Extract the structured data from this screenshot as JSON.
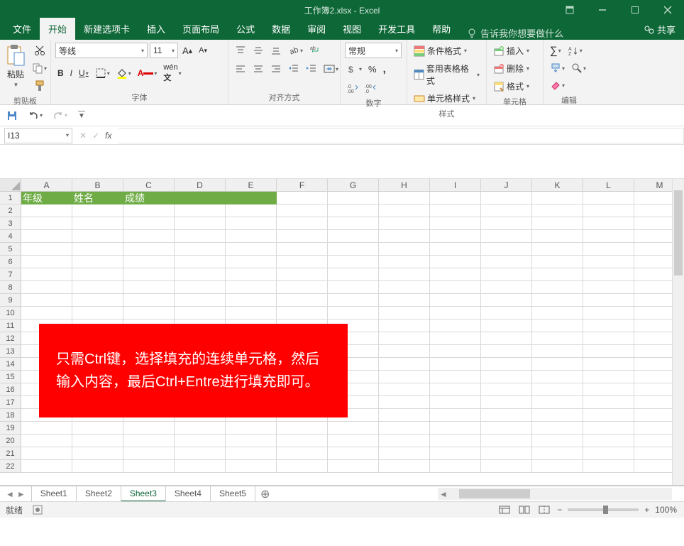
{
  "title": "工作簿2.xlsx  -  Excel",
  "menubar": {
    "file": "文件",
    "home": "开始",
    "new": "新建选项卡",
    "insert": "插入",
    "layout": "页面布局",
    "formula": "公式",
    "data": "数据",
    "review": "审阅",
    "view": "视图",
    "dev": "开发工具",
    "help": "帮助",
    "tell": "告诉我你想要做什么",
    "share": "共享"
  },
  "ribbon": {
    "clipboard": {
      "label": "剪贴板",
      "paste": "粘贴"
    },
    "font": {
      "label": "字体",
      "name": "等线",
      "size": "11",
      "bold": "B",
      "italic": "I",
      "underline": "U"
    },
    "align": {
      "label": "对齐方式"
    },
    "number": {
      "label": "数字",
      "format": "常规"
    },
    "styles": {
      "label": "样式",
      "cond": "条件格式",
      "table": "套用表格格式",
      "cell": "单元格样式"
    },
    "cells": {
      "label": "单元格",
      "insert": "插入",
      "delete": "删除",
      "format": "格式"
    },
    "editing": {
      "label": "编辑"
    }
  },
  "namebox": "I13",
  "columns": [
    "A",
    "B",
    "C",
    "D",
    "E",
    "F",
    "G",
    "H",
    "I",
    "J",
    "K",
    "L",
    "M"
  ],
  "rows": [
    "1",
    "2",
    "3",
    "4",
    "5",
    "6",
    "7",
    "8",
    "9",
    "10",
    "11",
    "12",
    "13",
    "14",
    "15",
    "16",
    "17",
    "18",
    "19",
    "20",
    "21",
    "22"
  ],
  "header_row": {
    "A": "年级",
    "B": "姓名",
    "C": "成绩",
    "D": "",
    "E": ""
  },
  "redbox": "只需Ctrl键，选择填充的连续单元格，然后输入内容，最后Ctrl+Entre进行填充即可。",
  "sheets": [
    "Sheet1",
    "Sheet2",
    "Sheet3",
    "Sheet4",
    "Sheet5"
  ],
  "active_sheet": 2,
  "status": {
    "ready": "就绪",
    "zoom": "100%"
  }
}
